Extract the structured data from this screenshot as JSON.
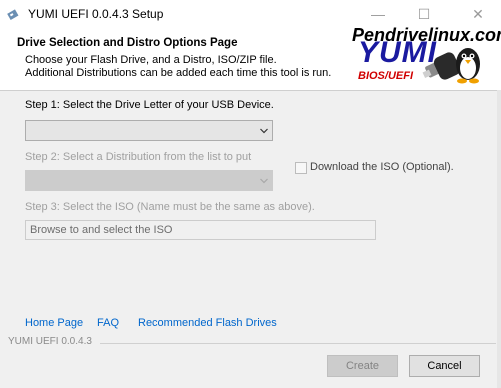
{
  "window": {
    "title": "YUMI UEFI 0.0.4.3 Setup",
    "minimize_glyph": "—",
    "maximize_glyph": "☐",
    "close_glyph": "✕"
  },
  "header": {
    "title": "Drive Selection and Distro Options Page",
    "desc_line1": "Choose your Flash Drive, and a Distro, ISO/ZIP file.",
    "desc_line2": "Additional Distributions can be added each time this tool is run.",
    "logo_site": "Pendrivelinux.com",
    "logo_name": "YUMI",
    "logo_sub": "BIOS/UEFI"
  },
  "step1": {
    "label": "Step 1: Select the Drive Letter of your USB Device.",
    "value": ""
  },
  "step2": {
    "label": "Step 2: Select a Distribution from the list to put",
    "value": "",
    "download_label": "Download the ISO (Optional).",
    "download_checked": false
  },
  "step3": {
    "label": "Step 3: Select the ISO (Name must be the same as above).",
    "browse_value": "Browse to and select the ISO"
  },
  "links": {
    "home": "Home Page",
    "faq": "FAQ",
    "drives": "Recommended Flash Drives"
  },
  "footer": {
    "version": "YUMI UEFI 0.0.4.3",
    "create_label": "Create",
    "cancel_label": "Cancel"
  },
  "colors": {
    "link": "#0066cc",
    "logo_blue": "#1a1aa0",
    "logo_red": "#d00000"
  }
}
